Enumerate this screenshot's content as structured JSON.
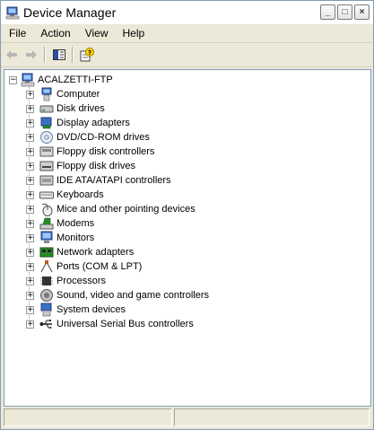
{
  "window": {
    "title": "Device Manager",
    "icon": "device-manager-icon",
    "buttons": {
      "minimize": "_",
      "maximize": "□",
      "close": "×"
    }
  },
  "menu": [
    "File",
    "Action",
    "View",
    "Help"
  ],
  "toolbar": {
    "back_icon": "back-arrow-icon",
    "forward_icon": "forward-arrow-icon",
    "show_hide_console_icon": "console-tree-icon",
    "help_icon": "help-icon"
  },
  "tree": {
    "root": {
      "label": "ACALZETTI-FTP",
      "icon": "computer-icon",
      "expander": "−"
    },
    "items": [
      {
        "label": "Computer",
        "icon": "computer-icon",
        "expander": "+"
      },
      {
        "label": "Disk drives",
        "icon": "disk-drive-icon",
        "expander": "+"
      },
      {
        "label": "Display adapters",
        "icon": "display-adapter-icon",
        "expander": "+"
      },
      {
        "label": "DVD/CD-ROM drives",
        "icon": "dvd-drive-icon",
        "expander": "+"
      },
      {
        "label": "Floppy disk controllers",
        "icon": "floppy-controller-icon",
        "expander": "+"
      },
      {
        "label": "Floppy disk drives",
        "icon": "floppy-drive-icon",
        "expander": "+"
      },
      {
        "label": "IDE ATA/ATAPI controllers",
        "icon": "ide-controller-icon",
        "expander": "+"
      },
      {
        "label": "Keyboards",
        "icon": "keyboard-icon",
        "expander": "+"
      },
      {
        "label": "Mice and other pointing devices",
        "icon": "mouse-icon",
        "expander": "+"
      },
      {
        "label": "Modems",
        "icon": "modem-icon",
        "expander": "+"
      },
      {
        "label": "Monitors",
        "icon": "monitor-icon",
        "expander": "+"
      },
      {
        "label": "Network adapters",
        "icon": "network-adapter-icon",
        "expander": "+"
      },
      {
        "label": "Ports (COM & LPT)",
        "icon": "port-icon",
        "expander": "+"
      },
      {
        "label": "Processors",
        "icon": "processor-icon",
        "expander": "+"
      },
      {
        "label": "Sound, video and game controllers",
        "icon": "sound-icon",
        "expander": "+"
      },
      {
        "label": "System devices",
        "icon": "system-device-icon",
        "expander": "+"
      },
      {
        "label": "Universal Serial Bus controllers",
        "icon": "usb-icon",
        "expander": "+"
      }
    ]
  },
  "status": [
    "",
    ""
  ]
}
